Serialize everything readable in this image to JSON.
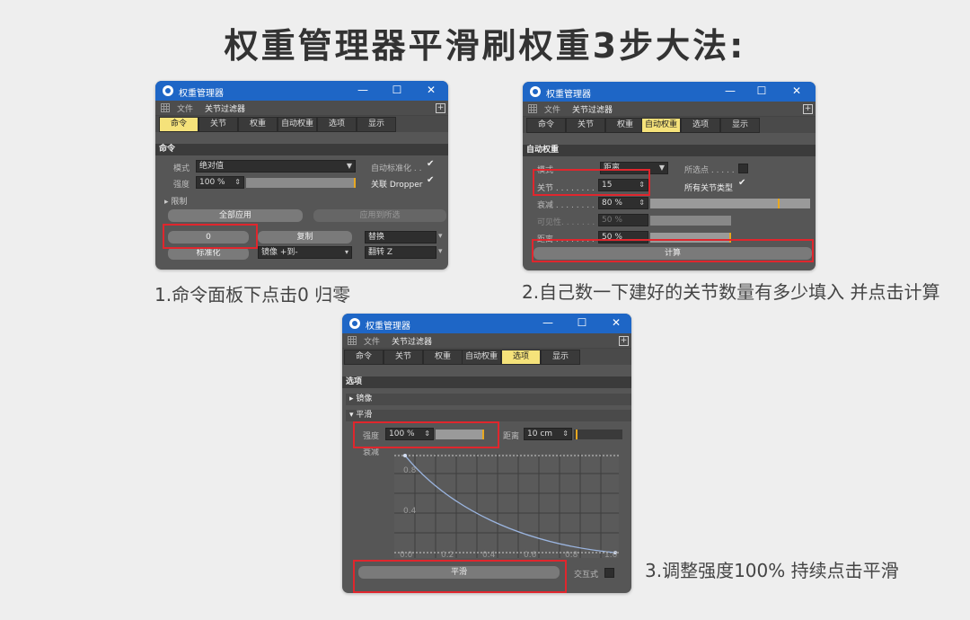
{
  "main_title": "权重管理器平滑刷权重3步大法:",
  "captions": {
    "step1": "1.命令面板下点击0 归零",
    "step2": "2.自己数一下建好的关节数量有多少填入 并点击计算",
    "step3": "3.调整强度100%  持续点击平滑"
  },
  "window": {
    "title": "权重管理器",
    "minimize": "—",
    "maximize": "☐",
    "close": "✕",
    "menu_file": "文件",
    "menu_filter": "关节过滤器",
    "tabs": [
      "命令",
      "关节",
      "权重",
      "自动权重",
      "选项",
      "显示"
    ]
  },
  "win1": {
    "section": "命令",
    "mode_label": "模式",
    "mode_value": "绝对值",
    "strength_label": "强度",
    "strength_value": "100 %",
    "strength_fraction": 1.0,
    "auto_normalize_label": "自动标准化 . .",
    "dropper_label": "关联 Dropper",
    "limit_label": "限制",
    "apply_all": "全部应用",
    "apply_selected": "应用到所选",
    "zero_button": "0",
    "copy_button": "复制",
    "replace_button": "替换",
    "normalize_button": "标准化",
    "mirror_value": "镜像 +到-",
    "flip_value": "翻转 Z"
  },
  "win2": {
    "section": "自动权重",
    "mode_label": "模式",
    "mode_value": "距离",
    "selected_points_label": "所选点 . . . . .",
    "joints_label": "关节 . . . . . . . .",
    "joints_value": "15",
    "all_joint_types_label": "所有关节类型",
    "falloff_label": "衰减 . . . . . . . .",
    "falloff_value": "80 %",
    "falloff_fraction": 0.8,
    "visibility_label": "可见性. . . . . . .",
    "visibility_value": "50 %",
    "visibility_fraction": 0.5,
    "distance_label": "距离 . . . . . . . .",
    "distance_value": "50 %",
    "distance_fraction": 0.5,
    "calculate_button": "计算"
  },
  "win3": {
    "section": "选项",
    "mirror_group": "镜像",
    "smooth_group": "平滑",
    "strength_label": "强度",
    "strength_value": "100 %",
    "distance_label": "距离",
    "distance_value": "10 cm",
    "falloff_label": "衰减",
    "graph_y_ticks": [
      "0.8",
      "0.4"
    ],
    "graph_x_ticks": [
      "0.0",
      "0.2",
      "0.4",
      "0.6",
      "0.8",
      "1.0"
    ],
    "smooth_button": "平滑",
    "interactive_label": "交互式"
  },
  "colors": {
    "titlebar": "#1e66c6",
    "active_tab": "#f5e27a",
    "highlight_box": "#e0262d",
    "panel": "#565656"
  }
}
